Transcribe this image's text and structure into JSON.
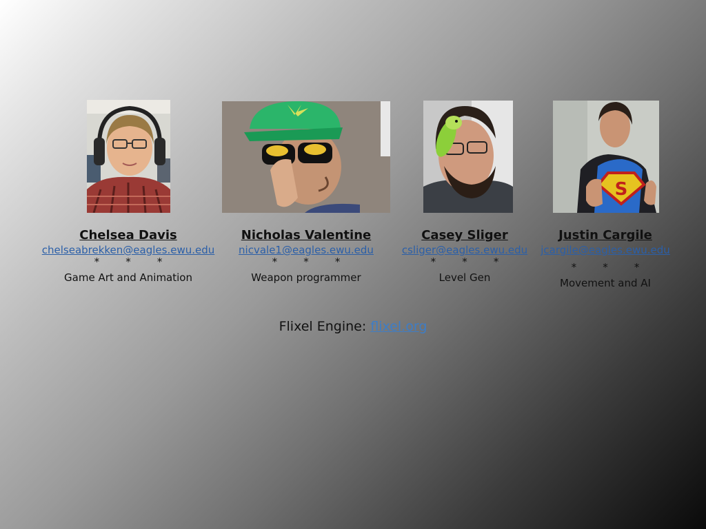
{
  "team": [
    {
      "name": "Chelsea Davis",
      "email": "chelseabrekken@eagles.ewu.edu",
      "stars": "*        *        *",
      "role": "Game Art and Animation"
    },
    {
      "name": "Nicholas Valentine",
      "email": "nicvale1@eagles.ewu.edu",
      "stars": "*        *        *",
      "role": "Weapon programmer"
    },
    {
      "name": "Casey Sliger",
      "email": "csliger@eagles.ewu.edu",
      "stars": "*        *        *",
      "role": "Level Gen"
    },
    {
      "name": "Justin Cargile",
      "email": "jcargile@eagles.ewu.edu",
      "stars": "*        *        *",
      "role": "Movement and AI"
    }
  ],
  "engine": {
    "label": "Flixel Engine: ",
    "link": "flixel.org"
  },
  "photos": [
    {
      "icon": "person-with-headphones-photo"
    },
    {
      "icon": "person-with-green-cap-and-sunglasses-photo"
    },
    {
      "icon": "person-with-parrot-photo"
    },
    {
      "icon": "person-in-superman-shirt-photo"
    }
  ]
}
